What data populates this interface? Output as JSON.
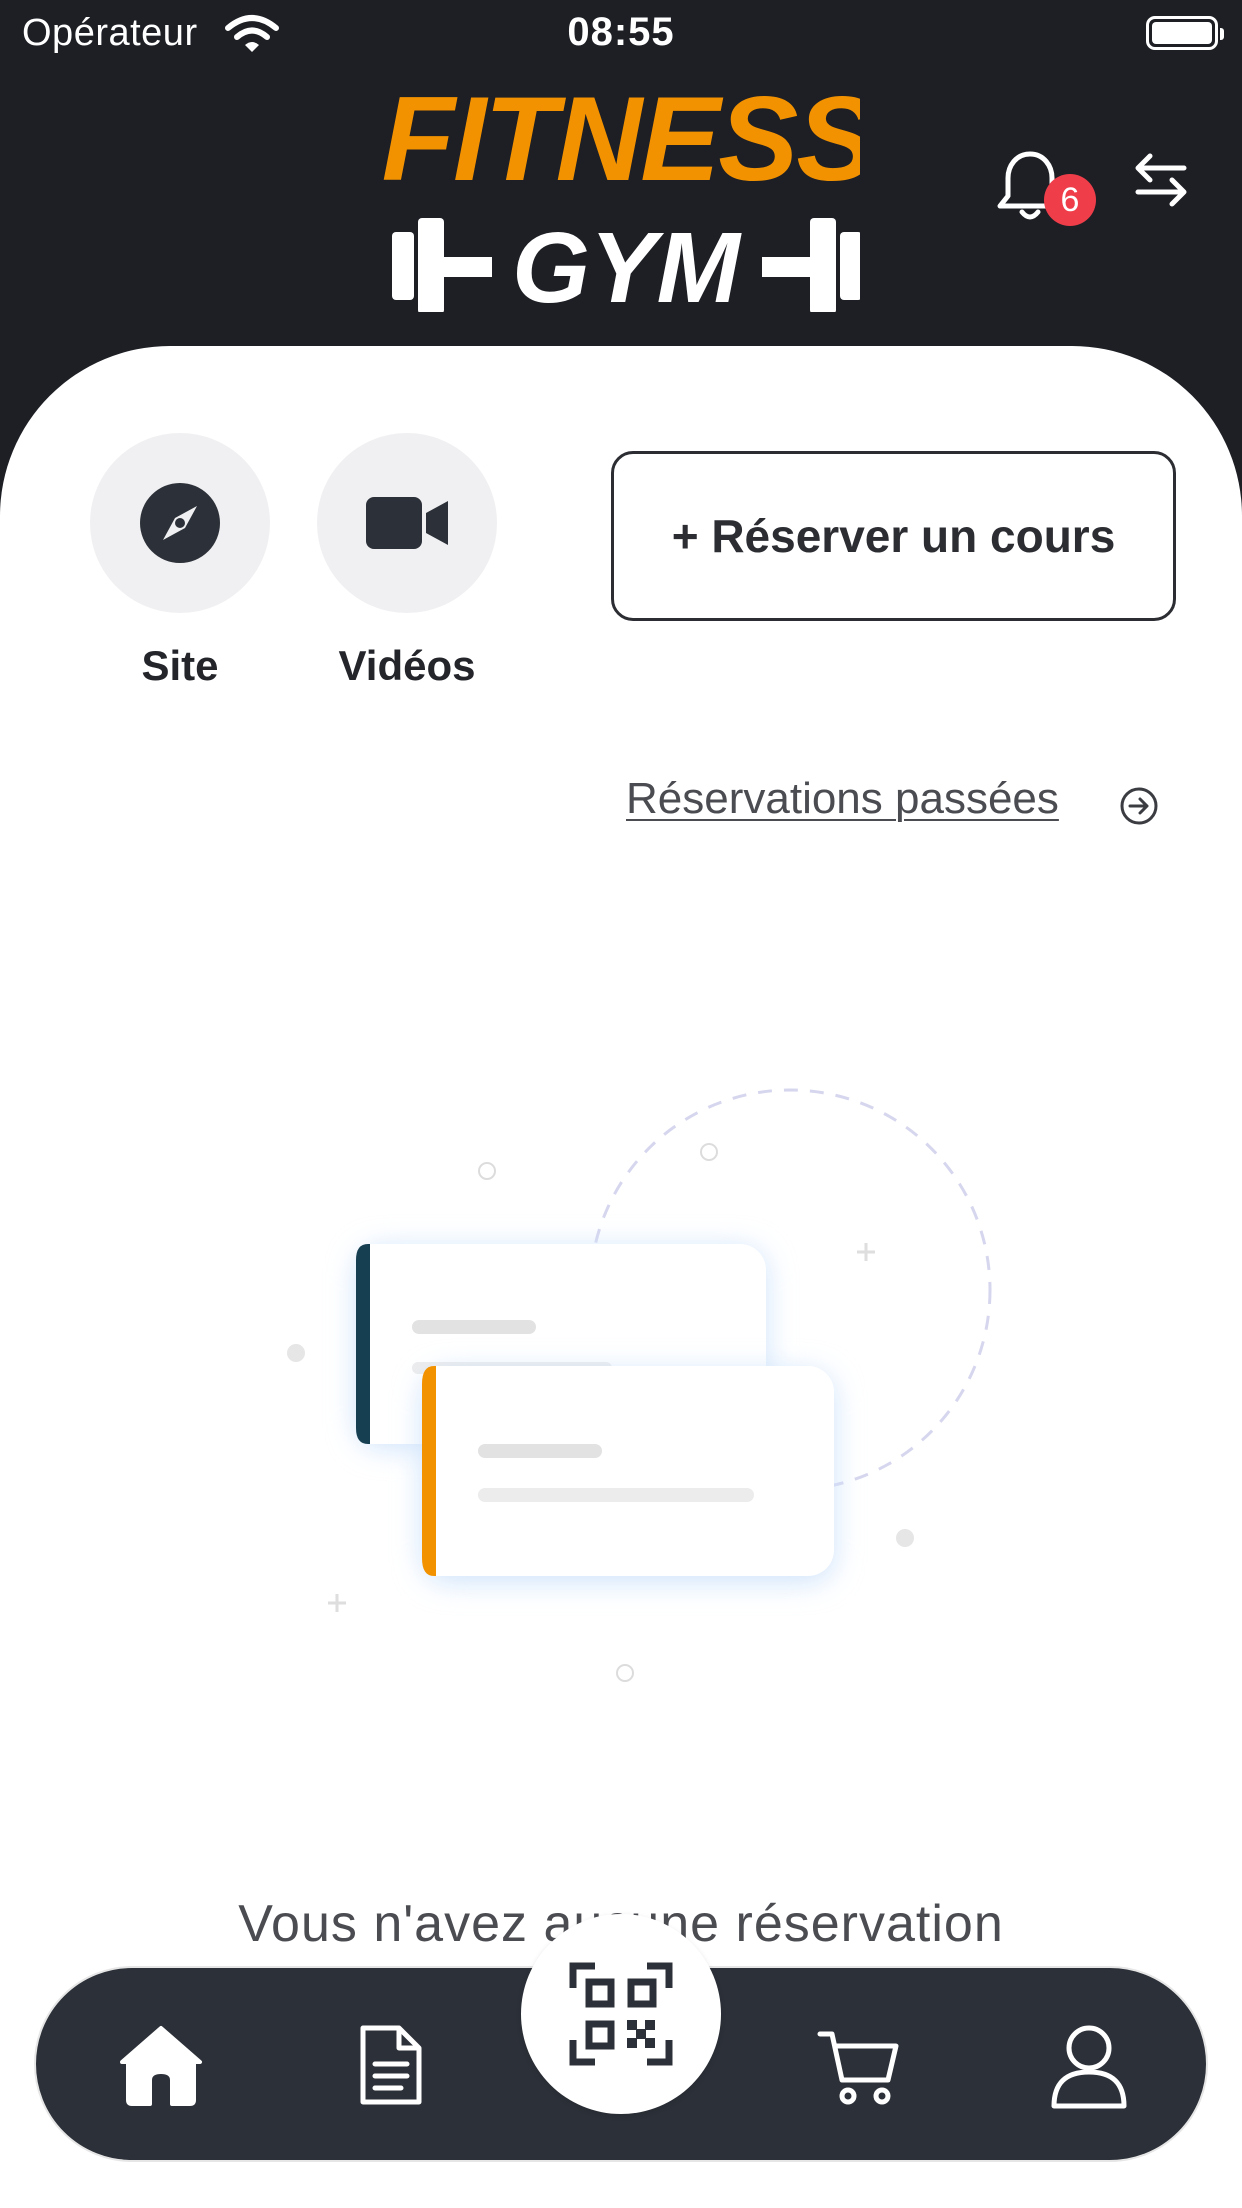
{
  "status_bar": {
    "carrier": "Opérateur",
    "time": "08:55"
  },
  "header": {
    "logo_line1": "FITNESS",
    "logo_line2": "GYM",
    "notification_count": "6"
  },
  "shortcuts": [
    {
      "label": "Site",
      "icon": "compass-icon"
    },
    {
      "label": "Vidéos",
      "icon": "video-camera-icon"
    }
  ],
  "reserve_button_label": "+ Réserver un cours",
  "past_reservations_link": "Réservations passées",
  "empty_state_text": "Vous n'avez aucune réservation",
  "bottom_nav": {
    "items": [
      {
        "icon": "home-icon",
        "active": true
      },
      {
        "icon": "document-icon",
        "active": false
      },
      {
        "icon": "qr-code-icon",
        "active": false
      },
      {
        "icon": "cart-icon",
        "active": false
      },
      {
        "icon": "user-icon",
        "active": false
      }
    ]
  },
  "colors": {
    "header_bg": "#1d1f25",
    "brand_orange": "#f39200",
    "badge_red": "#ef3e4a",
    "nav_bg": "#2c3038",
    "card_accent_dark": "#173f52"
  }
}
